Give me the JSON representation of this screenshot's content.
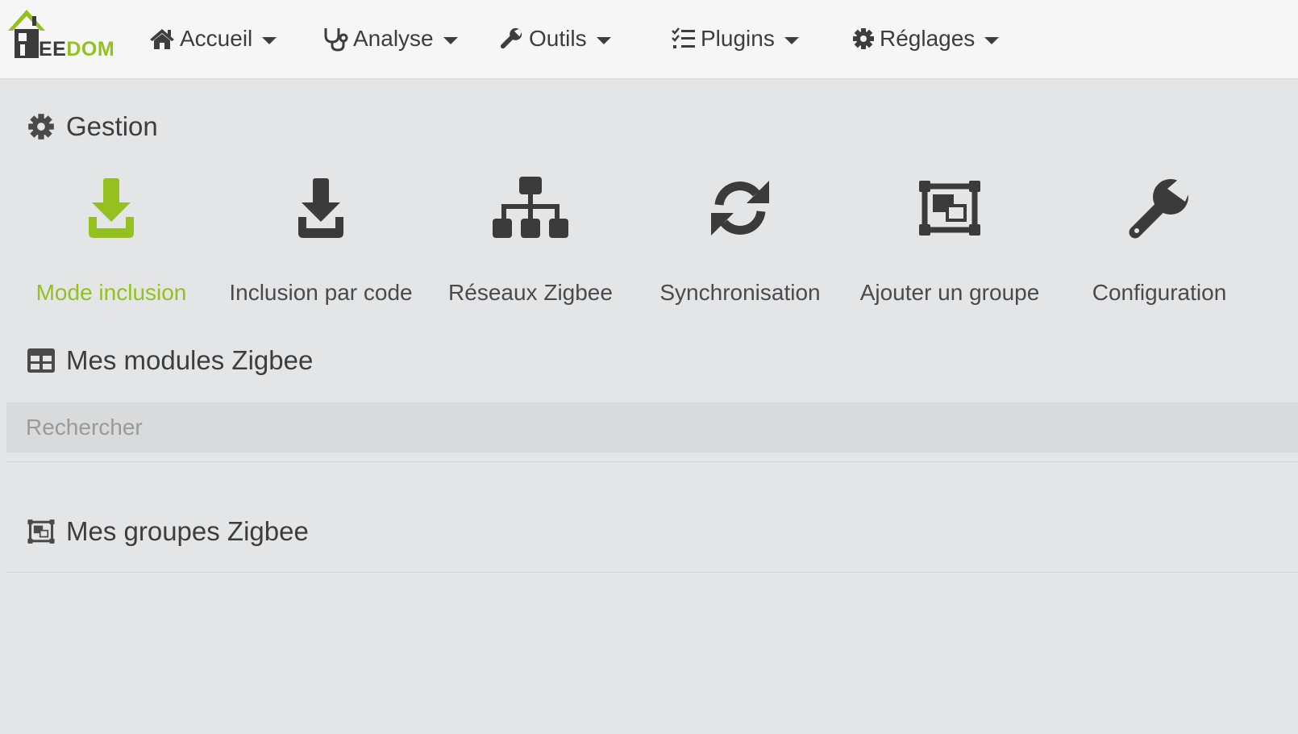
{
  "brand": {
    "logo_part1": "EE",
    "logo_part2": "DOM",
    "accent": "#94c11f"
  },
  "nav": [
    {
      "label": "Accueil",
      "icon": "home-icon"
    },
    {
      "label": "Analyse",
      "icon": "stethoscope-icon"
    },
    {
      "label": "Outils",
      "icon": "wrench-icon"
    },
    {
      "label": "Plugins",
      "icon": "tasks-icon"
    },
    {
      "label": "Réglages",
      "icon": "gear-icon"
    }
  ],
  "gestion": {
    "title": "Gestion",
    "actions": [
      {
        "label": "Mode inclusion",
        "icon": "download-icon",
        "active": true
      },
      {
        "label": "Inclusion par code",
        "icon": "download-icon"
      },
      {
        "label": "Réseaux Zigbee",
        "icon": "sitemap-icon"
      },
      {
        "label": "Synchronisation",
        "icon": "sync-icon"
      },
      {
        "label": "Ajouter un groupe",
        "icon": "object-group-icon"
      },
      {
        "label": "Configuration",
        "icon": "wrench-icon"
      }
    ]
  },
  "modules": {
    "title": "Mes modules Zigbee",
    "search_placeholder": "Rechercher"
  },
  "groups": {
    "title": "Mes groupes Zigbee"
  }
}
